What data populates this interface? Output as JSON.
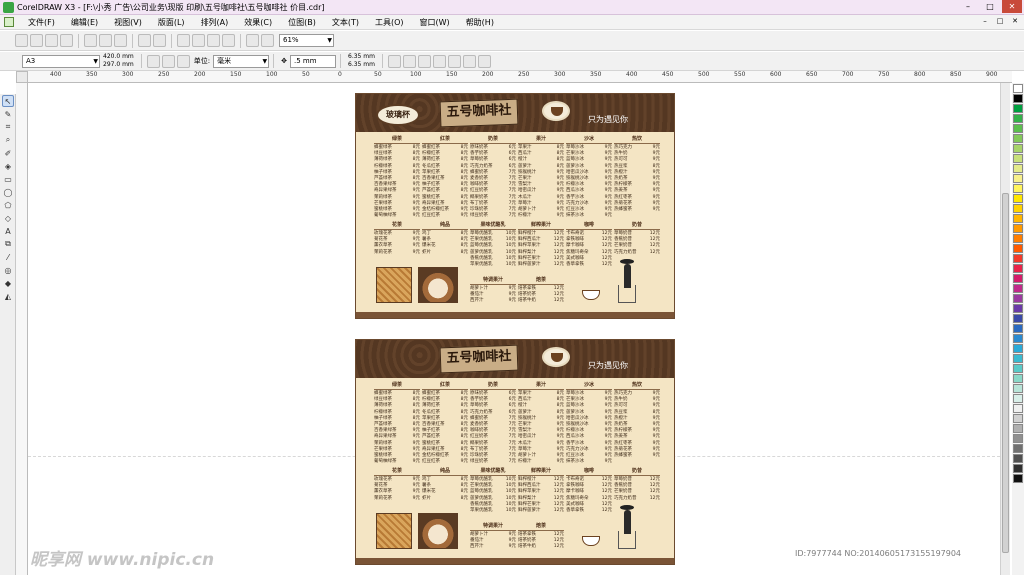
{
  "window": {
    "title": "CorelDRAW X3 - [F:\\小秀 广告\\公司业务\\现版 印刷\\五号咖啡社\\五号咖啡社 价目.cdr]",
    "controls": [
      "–",
      "□",
      "✕"
    ]
  },
  "menubar": {
    "items": [
      "文件(F)",
      "编辑(E)",
      "视图(V)",
      "版面(L)",
      "排列(A)",
      "效果(C)",
      "位图(B)",
      "文本(T)",
      "工具(O)",
      "窗口(W)",
      "帮助(H)"
    ]
  },
  "toolbar1": {
    "zoom_value": "61%"
  },
  "toolbar2": {
    "page_size": "A3",
    "width": "420.0 mm",
    "height": "297.0 mm",
    "unit_label": "单位:",
    "unit_value": "毫米",
    "nudge": ".5 mm",
    "dup_x": "6.35 mm",
    "dup_y": "6.35 mm"
  },
  "ruler": {
    "h_labels": [
      "400",
      "350",
      "300",
      "250",
      "200",
      "150",
      "100",
      "50",
      "0",
      "50",
      "100",
      "150",
      "200",
      "250",
      "300",
      "350",
      "400",
      "450",
      "500",
      "550",
      "600",
      "650",
      "700",
      "750",
      "800",
      "850",
      "900"
    ]
  },
  "menu_card": {
    "brand": "五号咖啡社",
    "badge": "玻璃杯",
    "slogan": "只为遇见你",
    "columns": [
      {
        "heading": "绿茶",
        "items": [
          [
            "蜂蜜绿茶",
            "8元"
          ],
          [
            "绿豆绿茶",
            "8元"
          ],
          [
            "薄荷绿茶",
            "8元"
          ],
          [
            "柠檬绿茶",
            "8元"
          ],
          [
            "柚子绿茶",
            "8元"
          ],
          [
            "芦荟绿茶",
            "8元"
          ],
          [
            "百香果绿茶",
            "9元"
          ],
          [
            "奇异果绿茶",
            "9元"
          ],
          [
            "茉莉绿茶",
            "9元"
          ],
          [
            "芒果绿茶",
            "9元"
          ],
          [
            "蜜桃绿茶",
            "9元"
          ],
          [
            "葡萄柚绿茶",
            "9元"
          ],
          [
            "菊花绿茶",
            "9元"
          ],
          [
            "草莓绿茶",
            "9元"
          ]
        ]
      },
      {
        "heading": "红茶",
        "items": [
          [
            "蜂蜜红茶",
            "8元"
          ],
          [
            "柠檬红茶",
            "8元"
          ],
          [
            "薄荷红茶",
            "8元"
          ],
          [
            "冬瓜红茶",
            "8元"
          ],
          [
            "苹果红茶",
            "8元"
          ],
          [
            "百香果红茶",
            "8元"
          ],
          [
            "柚子红茶",
            "8元"
          ],
          [
            "芦荟红茶",
            "8元"
          ],
          [
            "蜜桃红茶",
            "8元"
          ],
          [
            "奇异果红茶",
            "8元"
          ],
          [
            "金桔柠檬红茶",
            "9元"
          ],
          [
            "红豆红茶",
            "9元"
          ]
        ]
      },
      {
        "heading": "奶茶",
        "items": [
          [
            "原味奶茶",
            "6元"
          ],
          [
            "香芋奶茶",
            "6元"
          ],
          [
            "草莓奶茶",
            "6元"
          ],
          [
            "巧克力奶茶",
            "6元"
          ],
          [
            "蜂蜜奶茶",
            "7元"
          ],
          [
            "麦香奶茶",
            "7元"
          ],
          [
            "咖啡奶茶",
            "7元"
          ],
          [
            "红豆奶茶",
            "7元"
          ],
          [
            "椰果奶茶",
            "7元"
          ],
          [
            "布丁奶茶",
            "7元"
          ],
          [
            "珍珠奶茶",
            "7元"
          ],
          [
            "绿豆奶茶",
            "7元"
          ],
          [
            "薄荷奶茶",
            "7元"
          ],
          [
            "姜汁奶茶",
            "7元"
          ],
          [
            "抹茶奶茶",
            "7元"
          ]
        ]
      },
      {
        "heading": "果汁",
        "items": [
          [
            "苹果汁",
            "8元"
          ],
          [
            "西瓜汁",
            "8元"
          ],
          [
            "橙汁",
            "8元"
          ],
          [
            "菠萝汁",
            "8元"
          ],
          [
            "猕猴桃汁",
            "9元"
          ],
          [
            "芒果汁",
            "9元"
          ],
          [
            "雪梨汁",
            "9元"
          ],
          [
            "哈密瓜汁",
            "9元"
          ],
          [
            "木瓜汁",
            "9元"
          ],
          [
            "草莓汁",
            "9元"
          ],
          [
            "胡萝卜汁",
            "9元"
          ],
          [
            "柠檬汁",
            "9元"
          ]
        ]
      },
      {
        "heading": "沙冰",
        "items": [
          [
            "草莓沙冰",
            "9元"
          ],
          [
            "芒果沙冰",
            "9元"
          ],
          [
            "蓝莓沙冰",
            "9元"
          ],
          [
            "菠萝沙冰",
            "9元"
          ],
          [
            "哈密瓜沙冰",
            "9元"
          ],
          [
            "猕猴桃沙冰",
            "9元"
          ],
          [
            "柠檬沙冰",
            "9元"
          ],
          [
            "西瓜沙冰",
            "9元"
          ],
          [
            "香芋沙冰",
            "9元"
          ],
          [
            "巧克力沙冰",
            "9元"
          ],
          [
            "红豆沙冰",
            "9元"
          ],
          [
            "抹茶沙冰",
            "9元"
          ]
        ]
      },
      {
        "heading": "热饮",
        "items": [
          [
            "热巧克力",
            "9元"
          ],
          [
            "热牛奶",
            "9元"
          ],
          [
            "热可可",
            "9元"
          ],
          [
            "热豆浆",
            "8元"
          ],
          [
            "热橙汁",
            "9元"
          ],
          [
            "热奶茶",
            "9元"
          ],
          [
            "热柠檬茶",
            "9元"
          ],
          [
            "热姜茶",
            "9元"
          ],
          [
            "热红枣茶",
            "9元"
          ],
          [
            "热菊花茶",
            "9元"
          ],
          [
            "热蜂蜜茶",
            "9元"
          ]
        ]
      }
    ],
    "lower_sections": [
      {
        "heading": "花茶",
        "items": [
          [
            "玫瑰花茶",
            "9元"
          ],
          [
            "菊花茶",
            "9元"
          ],
          [
            "薰衣草茶",
            "9元"
          ],
          [
            "茉莉花茶",
            "9元"
          ],
          [
            "洛神花茶",
            "9元"
          ]
        ]
      },
      {
        "heading": "纯品",
        "items": [
          [
            "鸡丁",
            "8元"
          ],
          [
            "薯条",
            "8元"
          ],
          [
            "爆米花",
            "8元"
          ],
          [
            "虾片",
            "8元"
          ],
          [
            "鸡米花",
            "8元"
          ],
          [
            "可乐鸡翅",
            "8元"
          ]
        ]
      },
      {
        "heading": "果味优酪乳",
        "items": [
          [
            "草莓优酪乳",
            "10元"
          ],
          [
            "芒果优酪乳",
            "10元"
          ],
          [
            "蓝莓优酪乳",
            "10元"
          ],
          [
            "菠萝优酪乳",
            "10元"
          ],
          [
            "香蕉优酪乳",
            "10元"
          ],
          [
            "苹果优酪乳",
            "10元"
          ],
          [
            "蜜桃优酪乳",
            "10元"
          ]
        ]
      },
      {
        "heading": "鲜榨果汁",
        "items": [
          [
            "鲜榨橙汁",
            "12元"
          ],
          [
            "鲜榨西瓜汁",
            "12元"
          ],
          [
            "鲜榨苹果汁",
            "12元"
          ],
          [
            "鲜榨梨汁",
            "12元"
          ],
          [
            "鲜榨芒果汁",
            "12元"
          ],
          [
            "鲜榨菠萝汁",
            "12元"
          ]
        ]
      },
      {
        "heading": "咖啡",
        "items": [
          [
            "卡布奇诺",
            "12元"
          ],
          [
            "拿铁咖啡",
            "12元"
          ],
          [
            "摩卡咖啡",
            "12元"
          ],
          [
            "焦糖玛奇朵",
            "12元"
          ],
          [
            "美式咖啡",
            "12元"
          ],
          [
            "香草拿铁",
            "12元"
          ]
        ]
      },
      {
        "heading": "奶昔",
        "items": [
          [
            "草莓奶昔",
            "12元"
          ],
          [
            "香蕉奶昔",
            "12元"
          ],
          [
            "芒果奶昔",
            "12元"
          ],
          [
            "巧克力奶昔",
            "12元"
          ]
        ]
      }
    ],
    "extra_sections": [
      {
        "heading": "特调果汁",
        "items": [
          [
            "胡萝卜汁",
            "9元"
          ],
          [
            "番茄汁",
            "9元"
          ],
          [
            "西芹汁",
            "9元"
          ]
        ]
      },
      {
        "heading": "焙茶",
        "items": [
          [
            "焙茶拿铁",
            "12元"
          ],
          [
            "焙茶奶茶",
            "12元"
          ],
          [
            "焙茶牛奶",
            "12元"
          ]
        ]
      }
    ]
  },
  "watermark": {
    "left": "昵享网 www.nipic.cn",
    "right": "ID:7977744 NO:20140605173155197904"
  },
  "palette_colors": [
    "#ffffff",
    "#000000",
    "#00a040",
    "#34b24a",
    "#5cbf4e",
    "#84c95a",
    "#a8d46a",
    "#c8e07a",
    "#e4eb8a",
    "#f7f08b",
    "#fff45c",
    "#ffe600",
    "#ffd200",
    "#ffb600",
    "#ff9a00",
    "#ff7e00",
    "#ff5a00",
    "#f23a2a",
    "#e8244a",
    "#d41c6a",
    "#c02a8a",
    "#9a3aa0",
    "#6a3aa8",
    "#3a4aa8",
    "#2a6ac0",
    "#2a8ad0",
    "#2aaad8",
    "#3abad0",
    "#5acac8",
    "#8ad8c8",
    "#b8e4d8",
    "#d8eee8",
    "#efefef",
    "#d0d0d0",
    "#b0b0b0",
    "#909090",
    "#707070",
    "#505050",
    "#303030",
    "#101010"
  ]
}
